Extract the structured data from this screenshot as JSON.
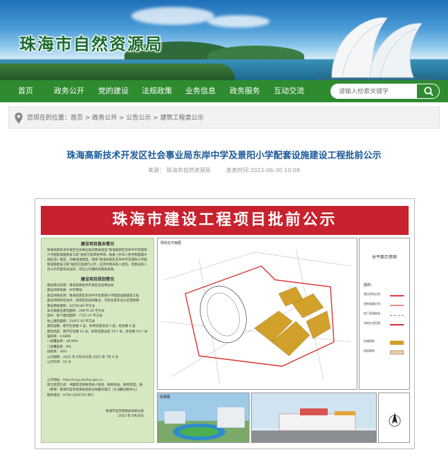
{
  "site": {
    "title": "珠海市自然资源局"
  },
  "nav": {
    "items": [
      {
        "label": "首页"
      },
      {
        "label": "政务公开"
      },
      {
        "label": "党的建设"
      },
      {
        "label": "法规政策"
      },
      {
        "label": "业务信息"
      },
      {
        "label": "政务服务"
      },
      {
        "label": "互动交流"
      }
    ],
    "search_placeholder": "请输入检索关键字"
  },
  "breadcrumb": {
    "text": "您现在的位置：首页 > 政务公开 > 公告公示 > 建筑工程类公示"
  },
  "article": {
    "title": "珠海高新技术开发区社会事业局东岸中学及景阳小学配套设施建设工程批前公示",
    "source": "来源：  珠海市自然资源局",
    "time": "发表时间:2022-06-30 10:08"
  },
  "board": {
    "heading": "珠海市建设工程项目批前公示",
    "info_title": "建设项目基本情况",
    "intro": "珠海高新技术开发区社会事业局向我局提出“珠海高新区东岸中学及景阳小学配套设施建设工程”规划方案审批申请，根据《中华人民共和国城乡规划法》规定，为确保透明度，现将“珠海高新区东岸中学及景阳小学配套设施建设工程”规划方案进行公示，征求利害关系人意见。利害关系人对公示内容有异议的，可在公示期间向我局反映。",
    "detail_title": "建设项目规划情况",
    "details": [
      "建设单位名称：珠海高新技术开发区社会事业局",
      "建设项目性质：中学用地",
      "建设项目名称：珠海高新区东岸中学及景阳小学配套设施建设工程",
      "建设项目所在地点：高新区科技四路北、万科住宅东北小区西南侧",
      "建设用地面积：42756.89 平方米",
      "本次报建总建筑面积：29679.29 平方米",
      "其中：地下建筑面积：7721.37 平方米",
      "     地上建筑面积：21957.92 平方米",
      "建筑层数：教学实验楼 5 层，体育馆游泳馆 3 层，综合楼 4 层",
      "建筑高度：教学实验楼 22 米，体育馆游泳馆 19.7 米，综合楼 19.7 米",
      "容积率：0.6896",
      "一级覆盖率：28.99%",
      "二级覆盖率：8%",
      "绿地率：30%",
      "公示期限：2022 年 6月30日至 2022 年 7月 9 日",
      "公示时间：10 天"
    ],
    "contact_lines": [
      "公示网站：http://zrzyj.zhuhai.gov.cn",
      "意见反馈方式：书面意见请将有关人姓名、联系地址、联系电话，送（邮寄）珠海市自然资源局高新分局服务窗口（大洲路创新中心）",
      "联系电话：0756-3319735 郑工"
    ],
    "sign_lines": [
      "珠海市自然资源局高新分局",
      "2022 年 6月30日"
    ],
    "plan_label": "规划总平面图",
    "legend_title": "总平面示意图",
    "legend_sub": "图例：",
    "legend_rows": [
      {
        "label": "建设用地红线",
        "color": "#e23b3b"
      },
      {
        "label": "规划道路红线",
        "color": "#e88"
      },
      {
        "label": "地下室建筑线",
        "color": "#777"
      },
      {
        "label": "用地红线范围",
        "color": "#c33"
      },
      {
        "label": "拟建建筑",
        "color": "#d2a12b"
      },
      {
        "label": "保留建筑",
        "color": "#e8cfa0"
      }
    ],
    "render_label": "效果图"
  },
  "colors": {
    "nav_green": "#2e8b30",
    "title_blue": "#1a5a9a",
    "board_red": "#c8222e",
    "info_green": "#d5e8c1",
    "building_gold": "#d2a12b"
  }
}
